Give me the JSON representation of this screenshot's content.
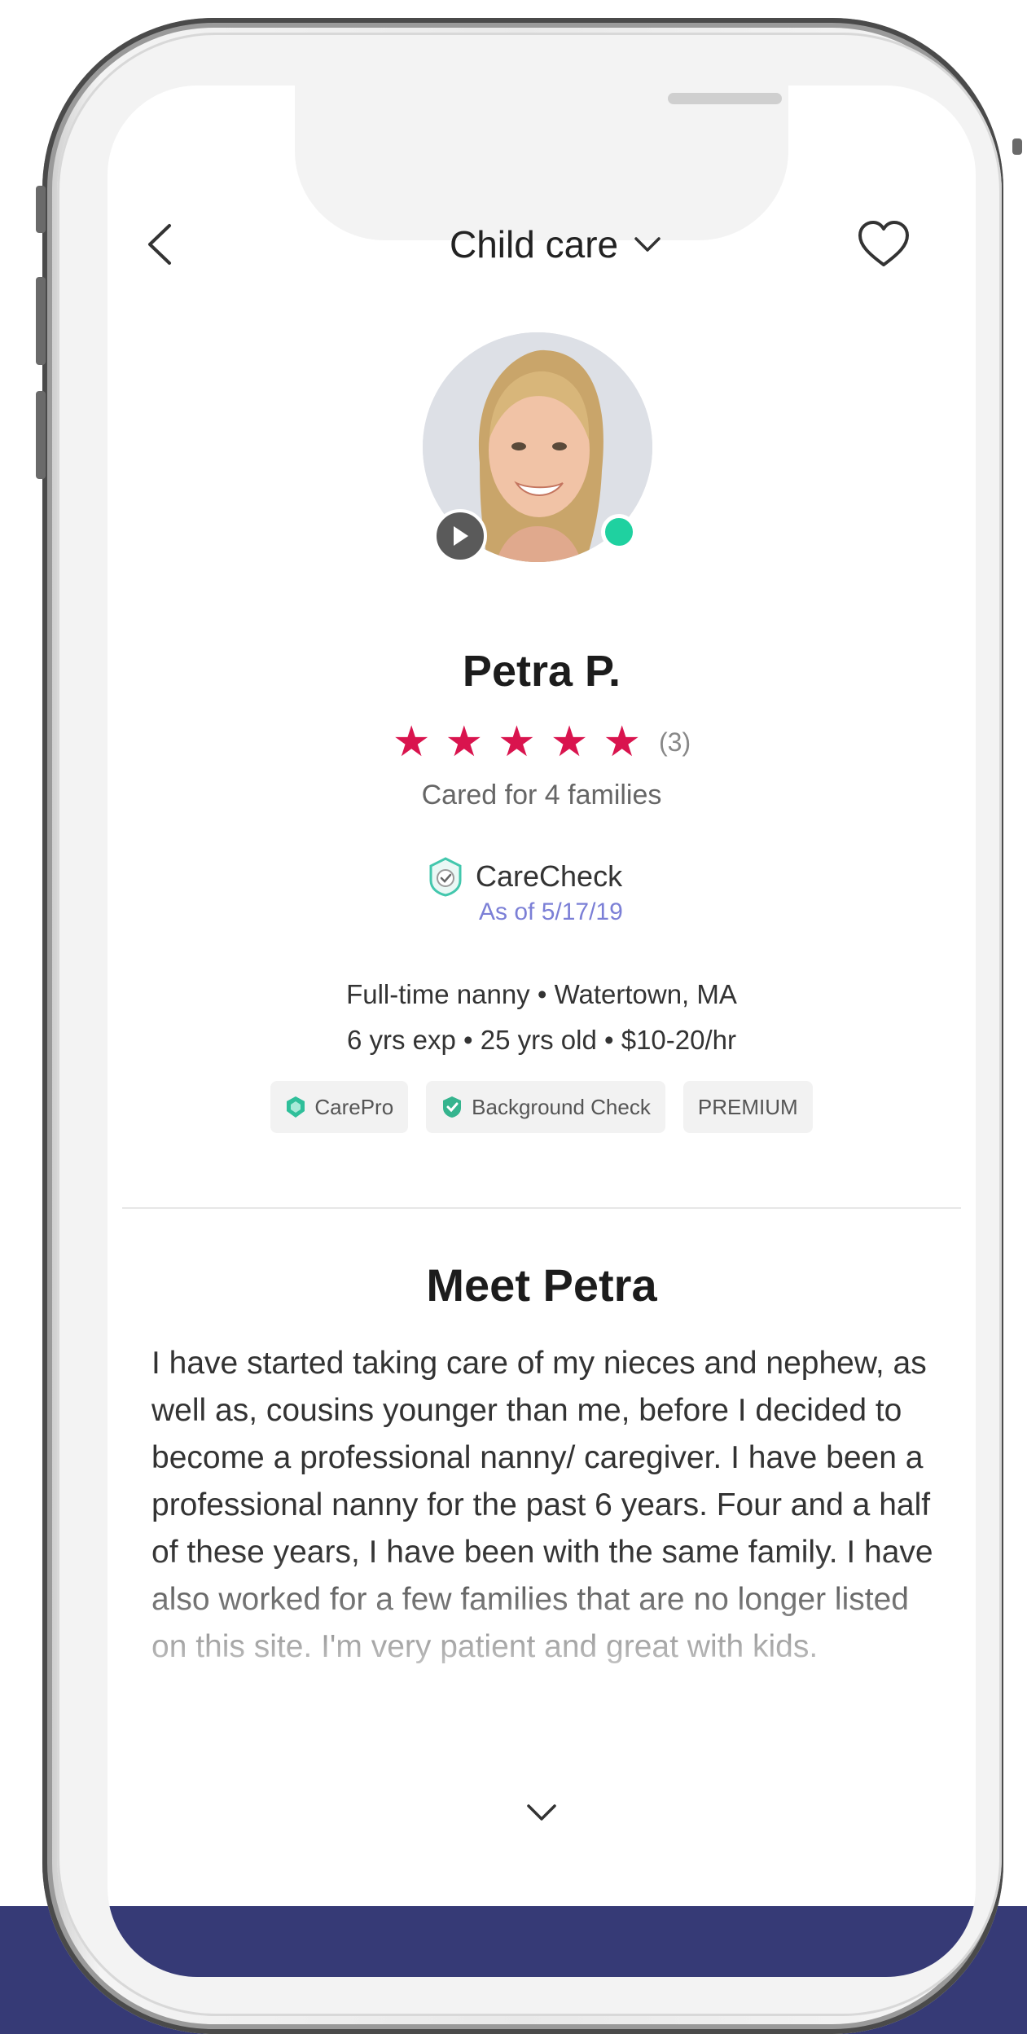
{
  "header": {
    "title": "Child care",
    "back_icon": "chevron-left-icon",
    "dropdown_icon": "chevron-down-icon",
    "favorite_icon": "heart-icon"
  },
  "profile": {
    "name": "Petra P.",
    "rating": 5,
    "rating_max": 5,
    "review_count": "(3)",
    "cared_for": "Cared for 4 families",
    "online": true
  },
  "carecheck": {
    "title": "CareCheck",
    "date": "As of 5/17/19"
  },
  "details": {
    "line1": "Full-time nanny • Watertown, MA",
    "line2": "6 yrs exp • 25 yrs old • $10-20/hr"
  },
  "badges": [
    {
      "label": "CarePro",
      "icon": "carepro-icon"
    },
    {
      "label": "Background Check",
      "icon": "shield-check-icon"
    },
    {
      "label": "PREMIUM"
    }
  ],
  "about": {
    "title": "Meet Petra",
    "text": "I have started taking care of my nieces and nephew, as well as, cousins younger than me, before I decided to become a professional nanny/ caregiver. I have been a professional nanny for the past 6 years. Four and a half of these years, I have been with the same family. I have also worked for a few families that are no longer listed on this site. I'm very patient and great with kids."
  },
  "colors": {
    "accent_star": "#d9144e",
    "online": "#1fd1a0",
    "link": "#7b7fd6",
    "band": "#363a76"
  }
}
